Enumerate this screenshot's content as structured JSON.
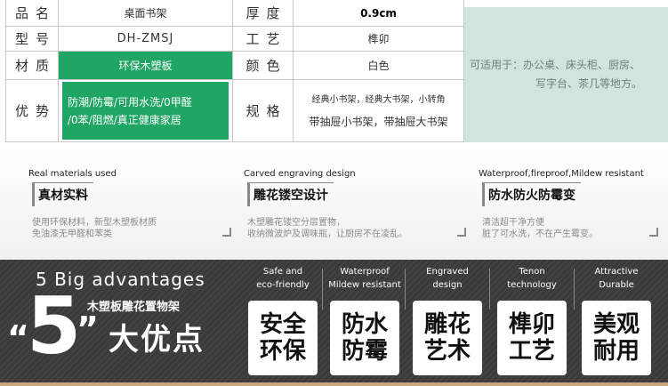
{
  "spec": {
    "rows": [
      {
        "label1": "品名",
        "value1": "桌面书架",
        "label2": "厚度",
        "value2": "0.9cm"
      },
      {
        "label1": "型号",
        "value1": "DH-ZMSJ",
        "label2": "工艺",
        "value2": "榫卯"
      },
      {
        "label1": "材质",
        "value1": "环保木塑板",
        "label2": "颜色",
        "value2": "白色"
      },
      {
        "label1": "优势",
        "value1_lines": [
          "防潮/防霉/可用水洗/0甲醛",
          "/0苯/阻燃/真正健康家居"
        ],
        "label2": "规格",
        "value2_lines": [
          "经典小书架，经典大书架，小转角",
          "带抽屉小书架，带抽屉大书架"
        ]
      }
    ],
    "usage": [
      "可适用于：办公桌、床头柜、厨房、",
      "写字台、茶几等地方。"
    ]
  },
  "features": [
    {
      "en": "Real materials used",
      "cn": "真材实料",
      "desc": [
        "使用环保材料，新型木塑板材质",
        "免油漆无甲醛和苯类"
      ]
    },
    {
      "en": "Carved engraving design",
      "cn": "雕花镂空设计",
      "desc": [
        "木塑雕花镂空分层置物，",
        "收纳微波炉及调味瓶，让厨房不在凌乱。"
      ]
    },
    {
      "en": "Waterproof,fireproof,Mildew resistant",
      "cn": "防水防火防霉变",
      "desc": [
        "清洁超干净方便",
        "脏了可水洗，不在产生霉变。"
      ]
    }
  ],
  "banner": {
    "title_en": "5  Big advantages",
    "five": "5",
    "quote_open": "“",
    "quote_close": "”",
    "sub_cn": "木塑板雕花置物架",
    "big_cn": "大优点",
    "advantages": [
      {
        "en": [
          "Safe and",
          "eco-friendly"
        ],
        "cn": [
          "安全",
          "环保"
        ]
      },
      {
        "en": [
          "Waterproof",
          "Mildew resistant"
        ],
        "cn": [
          "防水",
          "防霉"
        ]
      },
      {
        "en": [
          "Engraved",
          "design"
        ],
        "cn": [
          "雕花",
          "艺术"
        ]
      },
      {
        "en": [
          "Tenon",
          "technology"
        ],
        "cn": [
          "榫卯",
          "工艺"
        ]
      },
      {
        "en": [
          "Attractive",
          "Durable"
        ],
        "cn": [
          "美观",
          "耐用"
        ]
      }
    ],
    "accent_color": "#1fa564"
  }
}
